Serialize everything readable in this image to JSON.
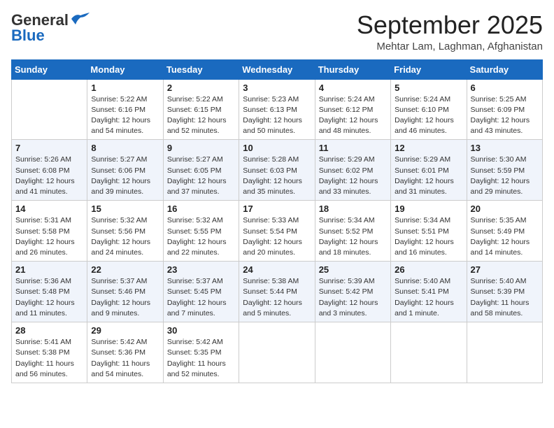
{
  "header": {
    "logo_line1": "General",
    "logo_line2": "Blue",
    "month": "September 2025",
    "location": "Mehtar Lam, Laghman, Afghanistan"
  },
  "weekdays": [
    "Sunday",
    "Monday",
    "Tuesday",
    "Wednesday",
    "Thursday",
    "Friday",
    "Saturday"
  ],
  "weeks": [
    [
      {
        "day": "",
        "info": ""
      },
      {
        "day": "1",
        "info": "Sunrise: 5:22 AM\nSunset: 6:16 PM\nDaylight: 12 hours\nand 54 minutes."
      },
      {
        "day": "2",
        "info": "Sunrise: 5:22 AM\nSunset: 6:15 PM\nDaylight: 12 hours\nand 52 minutes."
      },
      {
        "day": "3",
        "info": "Sunrise: 5:23 AM\nSunset: 6:13 PM\nDaylight: 12 hours\nand 50 minutes."
      },
      {
        "day": "4",
        "info": "Sunrise: 5:24 AM\nSunset: 6:12 PM\nDaylight: 12 hours\nand 48 minutes."
      },
      {
        "day": "5",
        "info": "Sunrise: 5:24 AM\nSunset: 6:10 PM\nDaylight: 12 hours\nand 46 minutes."
      },
      {
        "day": "6",
        "info": "Sunrise: 5:25 AM\nSunset: 6:09 PM\nDaylight: 12 hours\nand 43 minutes."
      }
    ],
    [
      {
        "day": "7",
        "info": "Sunrise: 5:26 AM\nSunset: 6:08 PM\nDaylight: 12 hours\nand 41 minutes."
      },
      {
        "day": "8",
        "info": "Sunrise: 5:27 AM\nSunset: 6:06 PM\nDaylight: 12 hours\nand 39 minutes."
      },
      {
        "day": "9",
        "info": "Sunrise: 5:27 AM\nSunset: 6:05 PM\nDaylight: 12 hours\nand 37 minutes."
      },
      {
        "day": "10",
        "info": "Sunrise: 5:28 AM\nSunset: 6:03 PM\nDaylight: 12 hours\nand 35 minutes."
      },
      {
        "day": "11",
        "info": "Sunrise: 5:29 AM\nSunset: 6:02 PM\nDaylight: 12 hours\nand 33 minutes."
      },
      {
        "day": "12",
        "info": "Sunrise: 5:29 AM\nSunset: 6:01 PM\nDaylight: 12 hours\nand 31 minutes."
      },
      {
        "day": "13",
        "info": "Sunrise: 5:30 AM\nSunset: 5:59 PM\nDaylight: 12 hours\nand 29 minutes."
      }
    ],
    [
      {
        "day": "14",
        "info": "Sunrise: 5:31 AM\nSunset: 5:58 PM\nDaylight: 12 hours\nand 26 minutes."
      },
      {
        "day": "15",
        "info": "Sunrise: 5:32 AM\nSunset: 5:56 PM\nDaylight: 12 hours\nand 24 minutes."
      },
      {
        "day": "16",
        "info": "Sunrise: 5:32 AM\nSunset: 5:55 PM\nDaylight: 12 hours\nand 22 minutes."
      },
      {
        "day": "17",
        "info": "Sunrise: 5:33 AM\nSunset: 5:54 PM\nDaylight: 12 hours\nand 20 minutes."
      },
      {
        "day": "18",
        "info": "Sunrise: 5:34 AM\nSunset: 5:52 PM\nDaylight: 12 hours\nand 18 minutes."
      },
      {
        "day": "19",
        "info": "Sunrise: 5:34 AM\nSunset: 5:51 PM\nDaylight: 12 hours\nand 16 minutes."
      },
      {
        "day": "20",
        "info": "Sunrise: 5:35 AM\nSunset: 5:49 PM\nDaylight: 12 hours\nand 14 minutes."
      }
    ],
    [
      {
        "day": "21",
        "info": "Sunrise: 5:36 AM\nSunset: 5:48 PM\nDaylight: 12 hours\nand 11 minutes."
      },
      {
        "day": "22",
        "info": "Sunrise: 5:37 AM\nSunset: 5:46 PM\nDaylight: 12 hours\nand 9 minutes."
      },
      {
        "day": "23",
        "info": "Sunrise: 5:37 AM\nSunset: 5:45 PM\nDaylight: 12 hours\nand 7 minutes."
      },
      {
        "day": "24",
        "info": "Sunrise: 5:38 AM\nSunset: 5:44 PM\nDaylight: 12 hours\nand 5 minutes."
      },
      {
        "day": "25",
        "info": "Sunrise: 5:39 AM\nSunset: 5:42 PM\nDaylight: 12 hours\nand 3 minutes."
      },
      {
        "day": "26",
        "info": "Sunrise: 5:40 AM\nSunset: 5:41 PM\nDaylight: 12 hours\nand 1 minute."
      },
      {
        "day": "27",
        "info": "Sunrise: 5:40 AM\nSunset: 5:39 PM\nDaylight: 11 hours\nand 58 minutes."
      }
    ],
    [
      {
        "day": "28",
        "info": "Sunrise: 5:41 AM\nSunset: 5:38 PM\nDaylight: 11 hours\nand 56 minutes."
      },
      {
        "day": "29",
        "info": "Sunrise: 5:42 AM\nSunset: 5:36 PM\nDaylight: 11 hours\nand 54 minutes."
      },
      {
        "day": "30",
        "info": "Sunrise: 5:42 AM\nSunset: 5:35 PM\nDaylight: 11 hours\nand 52 minutes."
      },
      {
        "day": "",
        "info": ""
      },
      {
        "day": "",
        "info": ""
      },
      {
        "day": "",
        "info": ""
      },
      {
        "day": "",
        "info": ""
      }
    ]
  ]
}
